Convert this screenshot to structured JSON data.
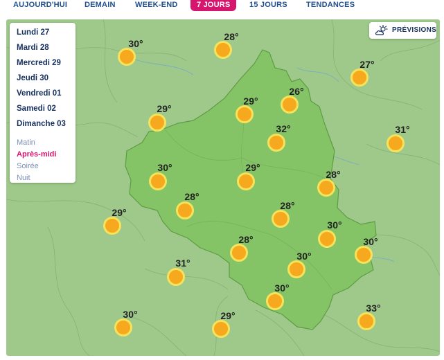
{
  "tabs": [
    {
      "label": "AUJOURD'HUI",
      "active": false
    },
    {
      "label": "DEMAIN",
      "active": false
    },
    {
      "label": "WEEK-END",
      "active": false
    },
    {
      "label": "7 JOURS",
      "active": true
    },
    {
      "label": "15 JOURS",
      "active": false
    },
    {
      "label": "TENDANCES",
      "active": false
    }
  ],
  "days": [
    "Lundi 27",
    "Mardi 28",
    "Mercredi 29",
    "Jeudi 30",
    "Vendredi 01",
    "Samedi 02",
    "Dimanche 03"
  ],
  "periods": [
    {
      "label": "Matin",
      "active": false
    },
    {
      "label": "Après-midi",
      "active": true
    },
    {
      "label": "Soirée",
      "active": false
    },
    {
      "label": "Nuit",
      "active": false
    }
  ],
  "previsions_label": "PRÉVISIONS",
  "previsions_icon": "cloud-sun-icon",
  "weather_icon": "sun-icon",
  "colors": {
    "accent": "#d6166e",
    "nav_text": "#1f4f8f",
    "region_fill": "#84c466",
    "map_base": "#9fc98a",
    "sun": "#f6a81f",
    "sun_ring": "#f6e35c"
  },
  "temperatures": [
    "28°",
    "30°",
    "27°",
    "29°",
    "26°",
    "29°",
    "32°",
    "31°",
    "30°",
    "29°",
    "28°",
    "28°",
    "29°",
    "28°",
    "30°",
    "30°",
    "28°",
    "31°",
    "30°",
    "30°",
    "29°",
    "33°"
  ]
}
